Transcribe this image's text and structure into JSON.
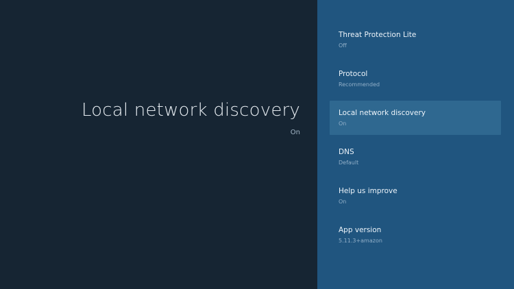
{
  "detail": {
    "title": "Local network discovery",
    "value": "On"
  },
  "settings": {
    "items": [
      {
        "title": "Threat Protection Lite",
        "value": "Off"
      },
      {
        "title": "Protocol",
        "value": "Recommended"
      },
      {
        "title": "Local network discovery",
        "value": "On",
        "selected": true
      },
      {
        "title": "DNS",
        "value": "Default"
      },
      {
        "title": "Help us improve",
        "value": "On"
      },
      {
        "title": "App version",
        "value": "5.11.3+amazon"
      }
    ]
  },
  "colors": {
    "left_background": "#162533",
    "right_background": "#20557f",
    "selected_item": "#2f6890"
  }
}
